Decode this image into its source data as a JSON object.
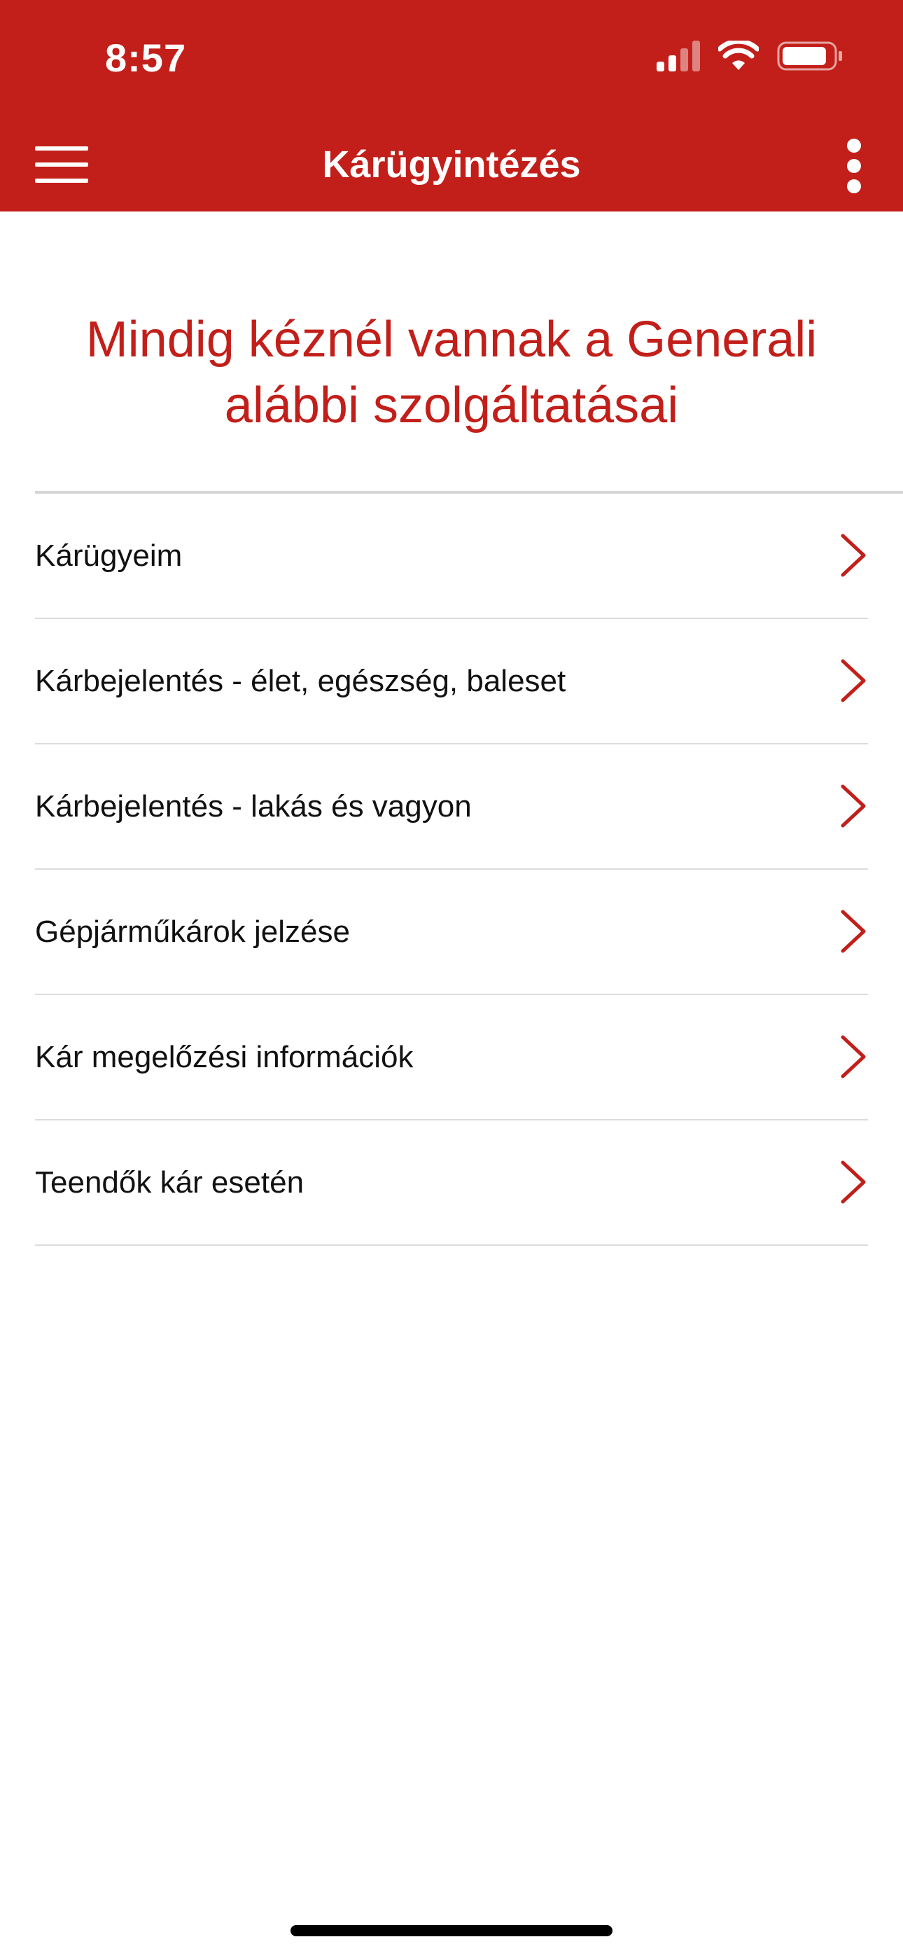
{
  "status_bar": {
    "time": "8:57",
    "signal_icon": "cellular-signal-icon",
    "wifi_icon": "wifi-icon",
    "battery_icon": "battery-icon"
  },
  "toolbar": {
    "title": "Kárügyintézés",
    "menu_icon": "hamburger-menu-icon",
    "more_icon": "vertical-ellipsis-icon"
  },
  "headline": {
    "line1": "Mindig kéznél vannak a Generali",
    "line2": "alábbi szolgáltatásai"
  },
  "menu": {
    "items": [
      {
        "label": "Kárügyeim"
      },
      {
        "label": "Kárbejelentés - élet, egészség, baleset"
      },
      {
        "label": "Kárbejelentés - lakás és vagyon"
      },
      {
        "label": "Gépjárműkárok jelzése"
      },
      {
        "label": "Kár megelőzési információk"
      },
      {
        "label": "Teendők kár esetén"
      }
    ],
    "chevron_icon": "chevron-right-icon"
  },
  "colors": {
    "brand_red": "#C21F1A",
    "text": "#111111",
    "divider": "#dcdcdc"
  }
}
